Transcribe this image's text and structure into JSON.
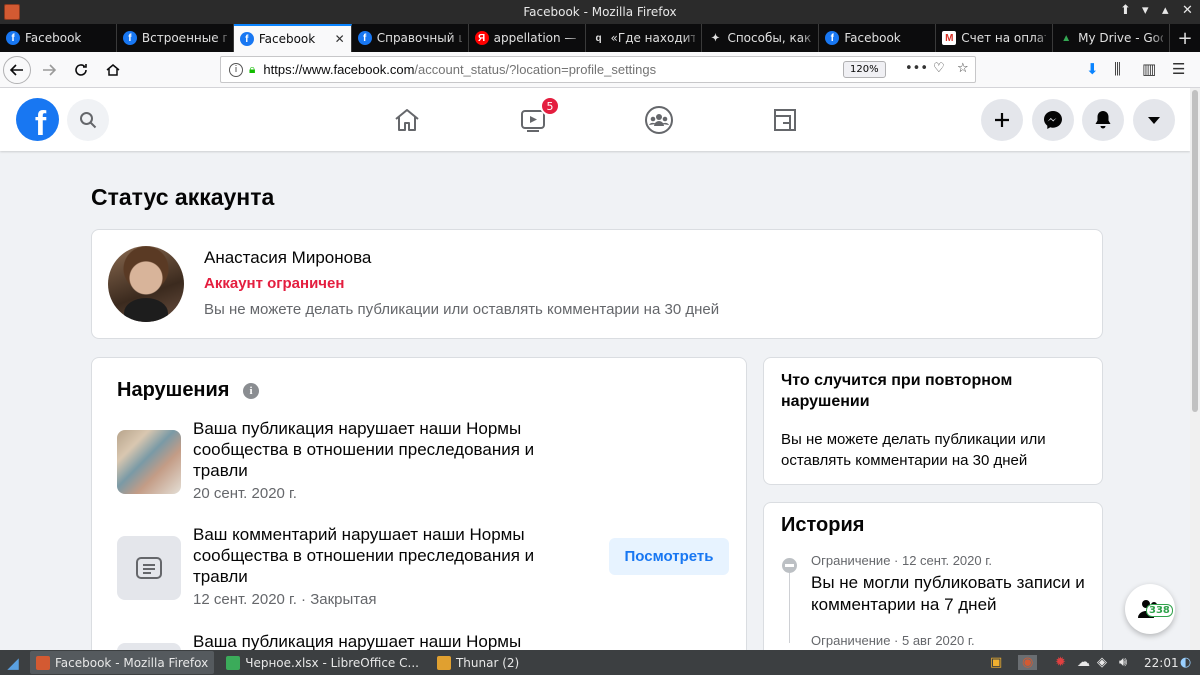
{
  "window": {
    "title": "Facebook - Mozilla Firefox"
  },
  "tabs": [
    {
      "label": "Facebook",
      "favicon": "facebook-icon",
      "color": "#1877f2",
      "active": false
    },
    {
      "label": "Встроенные пу",
      "favicon": "facebook-icon",
      "color": "#1877f2",
      "active": false
    },
    {
      "label": "Facebook",
      "favicon": "facebook-icon",
      "color": "#1877f2",
      "active": true
    },
    {
      "label": "Справочный ц",
      "favicon": "facebook-icon",
      "color": "#1877f2",
      "active": false
    },
    {
      "label": "appellation —",
      "favicon": "yandex-icon",
      "color": "#ff0000",
      "active": false
    },
    {
      "label": "«Где находитс",
      "favicon": "yandex-q-icon",
      "color": "#222222",
      "active": false
    },
    {
      "label": "Способы, как п",
      "favicon": "sparkle-icon",
      "color": "#0c0c0d",
      "active": false
    },
    {
      "label": "Facebook",
      "favicon": "facebook-icon",
      "color": "#1877f2",
      "active": false
    },
    {
      "label": "Счет на оплату",
      "favicon": "gmail-icon",
      "color": "#d93025",
      "active": false
    },
    {
      "label": "My Drive - Goo",
      "favicon": "google-drive-icon",
      "color": "#34a853",
      "active": false
    }
  ],
  "navbar": {
    "url_domain": "https://www.facebook.com",
    "url_path": "/account_status/?location=profile_settings",
    "zoom": "120%"
  },
  "fb_header": {
    "video_badge": "5"
  },
  "page": {
    "title": "Статус аккаунта",
    "profile": {
      "name": "Анастасия Миронова",
      "status": "Аккаунт ограничен",
      "description": "Вы не можете делать публикации или оставлять комментарии на 30 дней"
    },
    "violations": {
      "title": "Нарушения",
      "items": [
        {
          "text": "Ваша публикация нарушает наши Нормы сообщества в отношении преследования и травли",
          "date": "20 сент. 2020 г."
        },
        {
          "text": "Ваш комментарий нарушает наши Нормы сообщества в отношении преследования и травли",
          "date": "12 сент. 2020 г. · Закрытая",
          "button": "Посмотреть"
        },
        {
          "text": "Ваша публикация нарушает наши Нормы"
        }
      ]
    },
    "repeat": {
      "title": "Что случится при повторном нарушении",
      "text": "Вы не можете делать публикации или оставлять комментарии на 30 дней"
    },
    "history": {
      "title": "История",
      "items": [
        {
          "meta": "Ограничение · 12 сент. 2020 г.",
          "text": "Вы не могли публиковать записи и комментарии на 7 дней"
        },
        {
          "meta": "Ограничение · 5 авг 2020 г."
        }
      ]
    },
    "friends_count": "338"
  },
  "taskbar": {
    "items": [
      {
        "label": "Facebook - Mozilla Firefox",
        "active": true
      },
      {
        "label": "Черное.xlsx - LibreOffice C...",
        "active": false
      },
      {
        "label": "Thunar (2)",
        "active": false
      }
    ],
    "clock": "22:01"
  }
}
